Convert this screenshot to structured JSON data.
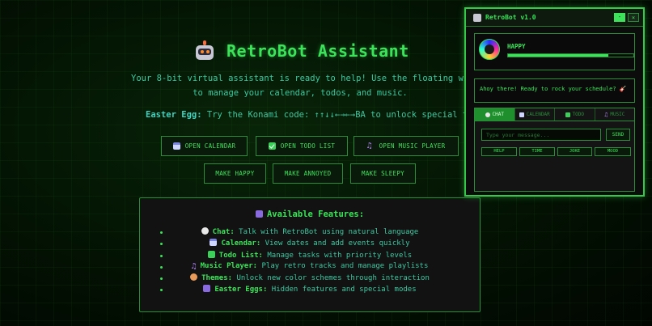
{
  "main": {
    "title": "RetroBot Assistant",
    "subtitle_line1": "Your 8-bit virtual assistant is ready to help! Use the floating window",
    "subtitle_line2": "to manage your calendar, todos, and music.",
    "easter_label": "Easter Egg:",
    "easter_text": " Try the Konami code: ↑↑↓↓←→←→BA to unlock special themes!",
    "buttons": {
      "open_calendar": "OPEN CALENDAR",
      "open_todo": "OPEN TODO LIST",
      "open_music": "OPEN MUSIC PLAYER",
      "make_happy": "MAKE HAPPY",
      "make_annoyed": "MAKE ANNOYED",
      "make_sleepy": "MAKE SLEEPY"
    }
  },
  "features": {
    "title": "Available Features:",
    "items": [
      {
        "icon": "speech-bubble-icon",
        "name": "Chat:",
        "desc": " Talk with RetroBot using natural language",
        "color": "#e8e8e8"
      },
      {
        "icon": "calendar-icon",
        "name": "Calendar:",
        "desc": " View dates and add events quickly",
        "color": "#cfd6ff"
      },
      {
        "icon": "checkbox-icon",
        "name": "Todo List:",
        "desc": " Manage tasks with priority levels",
        "color": "#3ccf5a"
      },
      {
        "icon": "music-note-icon",
        "name": "Music Player:",
        "desc": " Play retro tracks and manage playlists",
        "color": "#b98bff"
      },
      {
        "icon": "palette-icon",
        "name": "Themes:",
        "desc": " Unlock new color schemes through interaction",
        "color": "#e89a5a"
      },
      {
        "icon": "gamepad-icon",
        "name": "Easter Eggs:",
        "desc": " Hidden features and special modes",
        "color": "#8a6adf"
      }
    ]
  },
  "panel": {
    "title": "RetroBot v1.0",
    "minimize": "-",
    "close": "×",
    "mood": "HAPPY",
    "mood_level": 0.8,
    "speech": "Ahoy there! Ready to rock your schedule? 🎸",
    "tabs": [
      "CHAT",
      "CALENDAR",
      "TODO",
      "MUSIC"
    ],
    "input_placeholder": "Type your message...",
    "send": "SEND",
    "quick": [
      "HELP",
      "TIME",
      "JOKE",
      "MOOD"
    ]
  },
  "colors": {
    "accent": "#3ce35a",
    "border": "#2a8f3a",
    "text_secondary": "#3cc8a0"
  }
}
